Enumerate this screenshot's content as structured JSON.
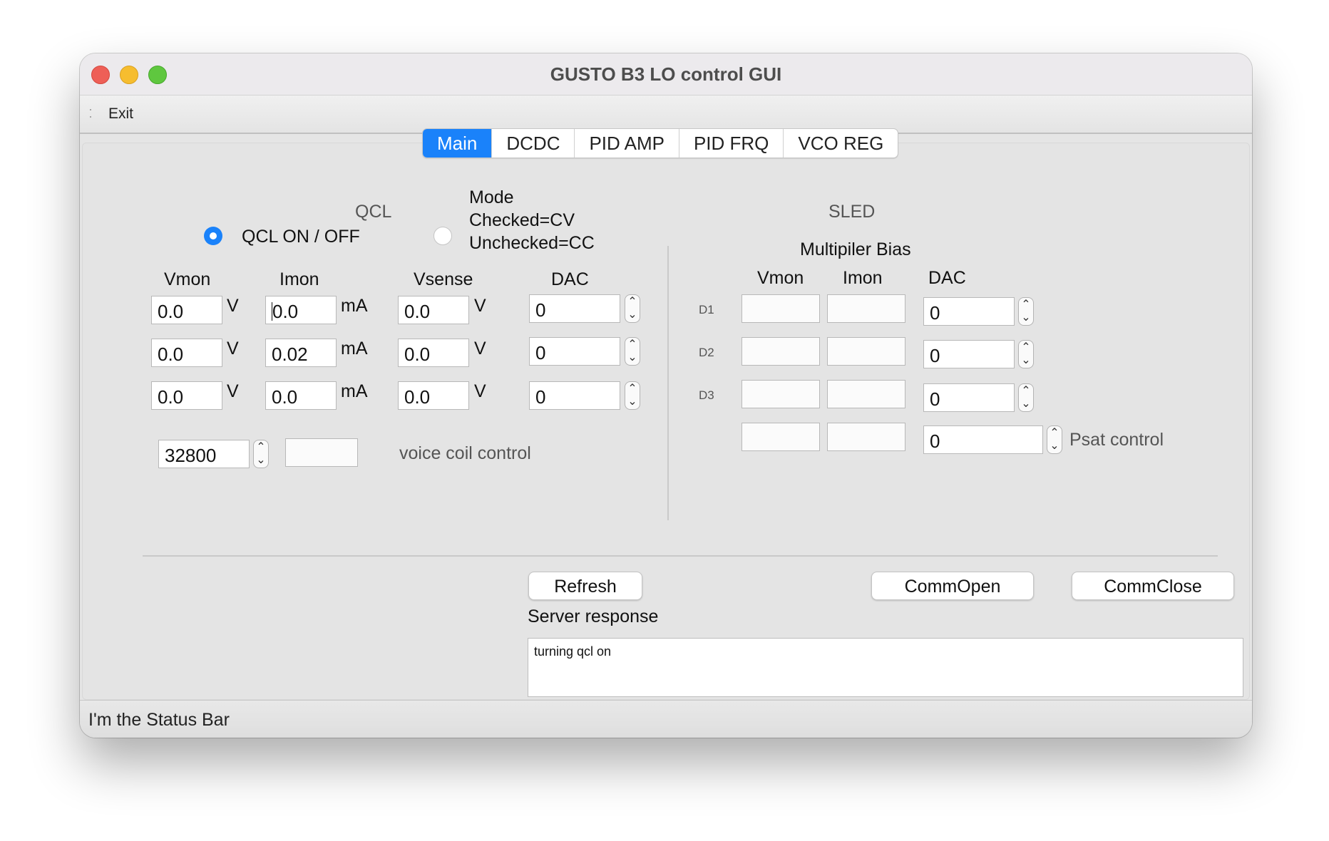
{
  "window": {
    "title": "GUSTO B3 LO control GUI"
  },
  "menubar": {
    "exit_label": "Exit"
  },
  "tabs": [
    {
      "label": "Main",
      "active": true
    },
    {
      "label": "DCDC",
      "active": false
    },
    {
      "label": "PID AMP",
      "active": false
    },
    {
      "label": "PID FRQ",
      "active": false
    },
    {
      "label": "VCO REG",
      "active": false
    }
  ],
  "qcl": {
    "section_label": "QCL",
    "onoff_label": "QCL ON / OFF",
    "onoff_checked": true,
    "mode_lines": [
      "Mode",
      "Checked=CV",
      "Unchecked=CC"
    ],
    "mode_checked": false,
    "headers": {
      "vmon": "Vmon",
      "imon": "Imon",
      "vsense": "Vsense",
      "dac": "DAC"
    },
    "units": {
      "v": "V",
      "ma": "mA"
    },
    "rows": [
      {
        "vmon": "0.0",
        "imon": "0.0",
        "vsense": "0.0",
        "dac": "0"
      },
      {
        "vmon": "0.0",
        "imon": "0.02",
        "vsense": "0.0",
        "dac": "0"
      },
      {
        "vmon": "0.0",
        "imon": "0.0",
        "vsense": "0.0",
        "dac": "0"
      }
    ],
    "voice_coil": {
      "value": "32800",
      "readout": "",
      "label": "voice coil control"
    }
  },
  "sled": {
    "section_label": "SLED",
    "group_label": "Multipiler Bias",
    "headers": {
      "vmon": "Vmon",
      "imon": "Imon",
      "dac": "DAC"
    },
    "rows": [
      {
        "label": "D1",
        "vmon": "",
        "imon": "",
        "dac": "0"
      },
      {
        "label": "D2",
        "vmon": "",
        "imon": "",
        "dac": "0"
      },
      {
        "label": "D3",
        "vmon": "",
        "imon": "",
        "dac": "0"
      },
      {
        "label": "",
        "vmon": "",
        "imon": "",
        "dac": "0"
      }
    ],
    "psat_label": "Psat control"
  },
  "buttons": {
    "refresh": "Refresh",
    "comm_open": "CommOpen",
    "comm_close": "CommClose"
  },
  "server_response": {
    "label": "Server response",
    "text": "turning qcl on"
  },
  "status_bar": {
    "text": "I'm the Status Bar"
  }
}
